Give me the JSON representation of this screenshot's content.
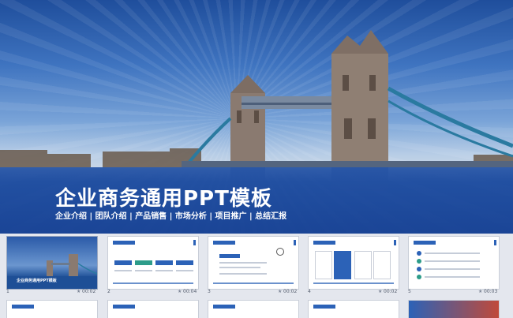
{
  "hero": {
    "title": "企业商务通用PPT模板",
    "subtitle": "企业介绍 | 团队介绍 | 产品销售 | 市场分析 | 项目推广 | 总结汇报"
  },
  "slides": [
    {
      "number": "1",
      "time": "00:02",
      "title": "企业商务通用PPT模板"
    },
    {
      "number": "2",
      "time": "00:04"
    },
    {
      "number": "3",
      "time": "00:02"
    },
    {
      "number": "4",
      "time": "00:02"
    },
    {
      "number": "5",
      "time": "00:03"
    }
  ],
  "colors": {
    "brand_blue": "#2c62b7",
    "band_blue": "#1e4f96"
  }
}
